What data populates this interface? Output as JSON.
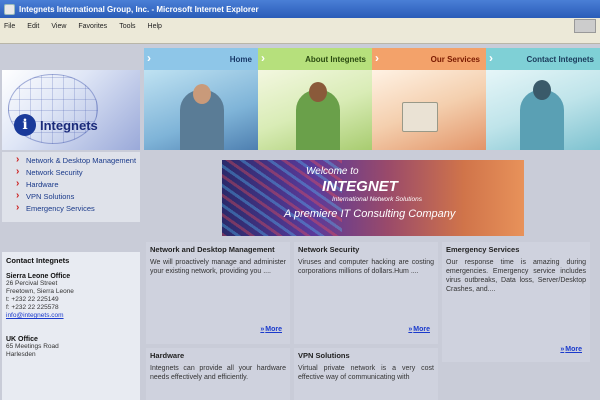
{
  "window": {
    "title": "Integnets International Group, Inc. - Microsoft Internet Explorer",
    "menu": [
      "File",
      "Edit",
      "View",
      "Favorites",
      "Tools",
      "Help"
    ]
  },
  "nav": {
    "tabs": [
      "Home",
      "About Integnets",
      "Our Services",
      "Contact Integnets"
    ]
  },
  "logo": {
    "text": "Integnets"
  },
  "sidebar": {
    "links": [
      "Network & Desktop Management",
      "Network Security",
      "Hardware",
      "VPN Solutions",
      "Emergency Services"
    ]
  },
  "contact": {
    "heading": "Contact Integnets",
    "sierra_leone": {
      "title": "Sierra Leone Office",
      "lines": [
        "26 Percival Street",
        "Freetown, Sierra Leone",
        "t: +232 22 225149",
        "f: +232 22 225578"
      ],
      "email": "info@integnets.com"
    },
    "uk": {
      "title": "UK Office",
      "lines": [
        "65 Meetings Road",
        "Harlesden"
      ]
    }
  },
  "banner": {
    "line1": "Welcome to",
    "line2": "INTEGNET",
    "line3": "International Network Solutions",
    "line4": "A premiere IT Consulting Company"
  },
  "services": {
    "more_label": "More",
    "network": {
      "title": "Network and Desktop Management",
      "text": "We will proactively manage and administer your existing network, providing you ...."
    },
    "security": {
      "title": "Network Security",
      "text": "Viruses and computer hacking are costing corporations millions of dollars.Hum ...."
    },
    "emergency": {
      "title": "Emergency Services",
      "text": "Our response time is amazing during emergencies. Emergency service includes virus outbreaks, Data loss, Server/Desktop Crashes, and...."
    },
    "hardware": {
      "title": "Hardware",
      "text": "Integnets can provide all your hardware needs effectively and efficiently."
    },
    "vpn": {
      "title": "VPN Solutions",
      "text": "Virtual private network is a very cost effective way of communicating with"
    }
  }
}
